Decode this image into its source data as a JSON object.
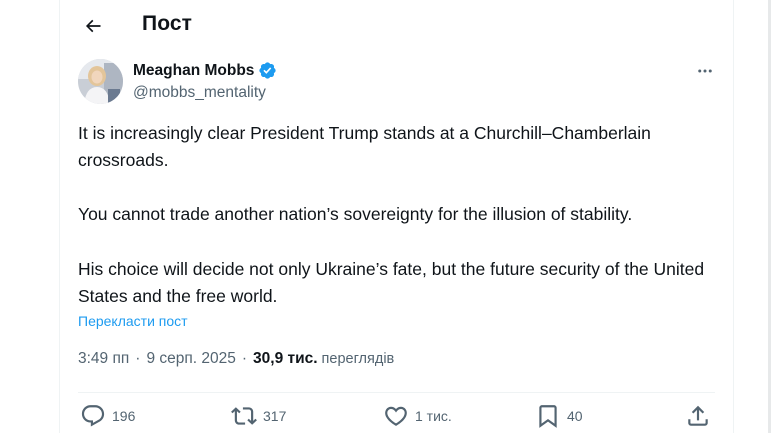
{
  "header": {
    "title": "Пост",
    "back_icon": "arrow-left-icon"
  },
  "post": {
    "author": {
      "name": "Meaghan Mobbs",
      "handle": "@mobbs_mentality",
      "verified": true
    },
    "paragraphs": [
      "It is increasingly clear President Trump stands at a Churchill–Chamberlain crossroads.",
      "You cannot trade another nation’s sovereignty for the illusion of stability.",
      "His choice will decide not only Ukraine’s fate, but the future security of the United States and the free world."
    ],
    "translate_label": "Перекласти пост",
    "time": "3:49 пп",
    "separator": "·",
    "date": "9 серп. 2025",
    "views_count": "30,9 тис.",
    "views_label": "переглядів"
  },
  "actions": {
    "replies": "196",
    "reposts": "317",
    "likes": "1 тис.",
    "bookmarks": "40"
  },
  "colors": {
    "accent": "#1d9bf0",
    "text": "#0f1419",
    "secondary": "#536471",
    "border": "#eff3f4"
  }
}
